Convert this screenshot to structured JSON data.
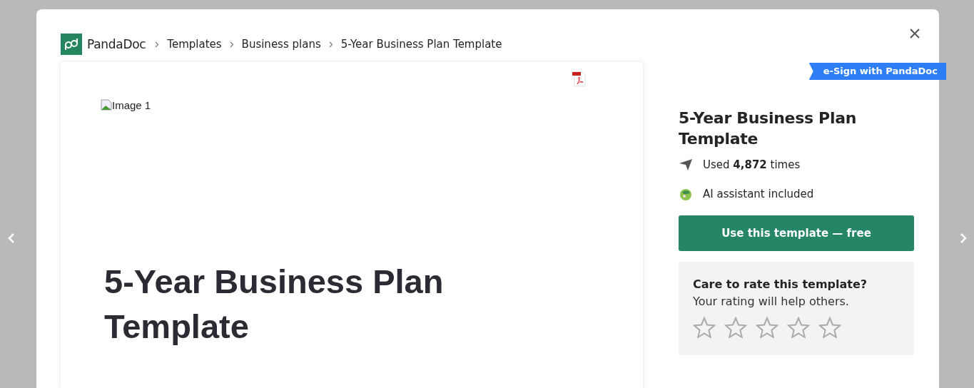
{
  "brand": {
    "name": "PandaDoc"
  },
  "breadcrumbs": [
    "Templates",
    "Business plans",
    "5-Year Business Plan Template"
  ],
  "document": {
    "image_alt": "Image 1",
    "title": "5-Year Business Plan Template"
  },
  "ribbon": "e-Sign with PandaDoc",
  "sidebar": {
    "title": "5-Year Business Plan Template",
    "features": [
      {
        "kind": "usage",
        "text": "Used **4,872** times"
      },
      {
        "kind": "ai",
        "text": "AI assistant included"
      }
    ],
    "primary_button": "Use this template — free",
    "rating": {
      "title": "Care to rate this template?",
      "subtitle": "Your rating will help others.",
      "stars": 0
    }
  }
}
